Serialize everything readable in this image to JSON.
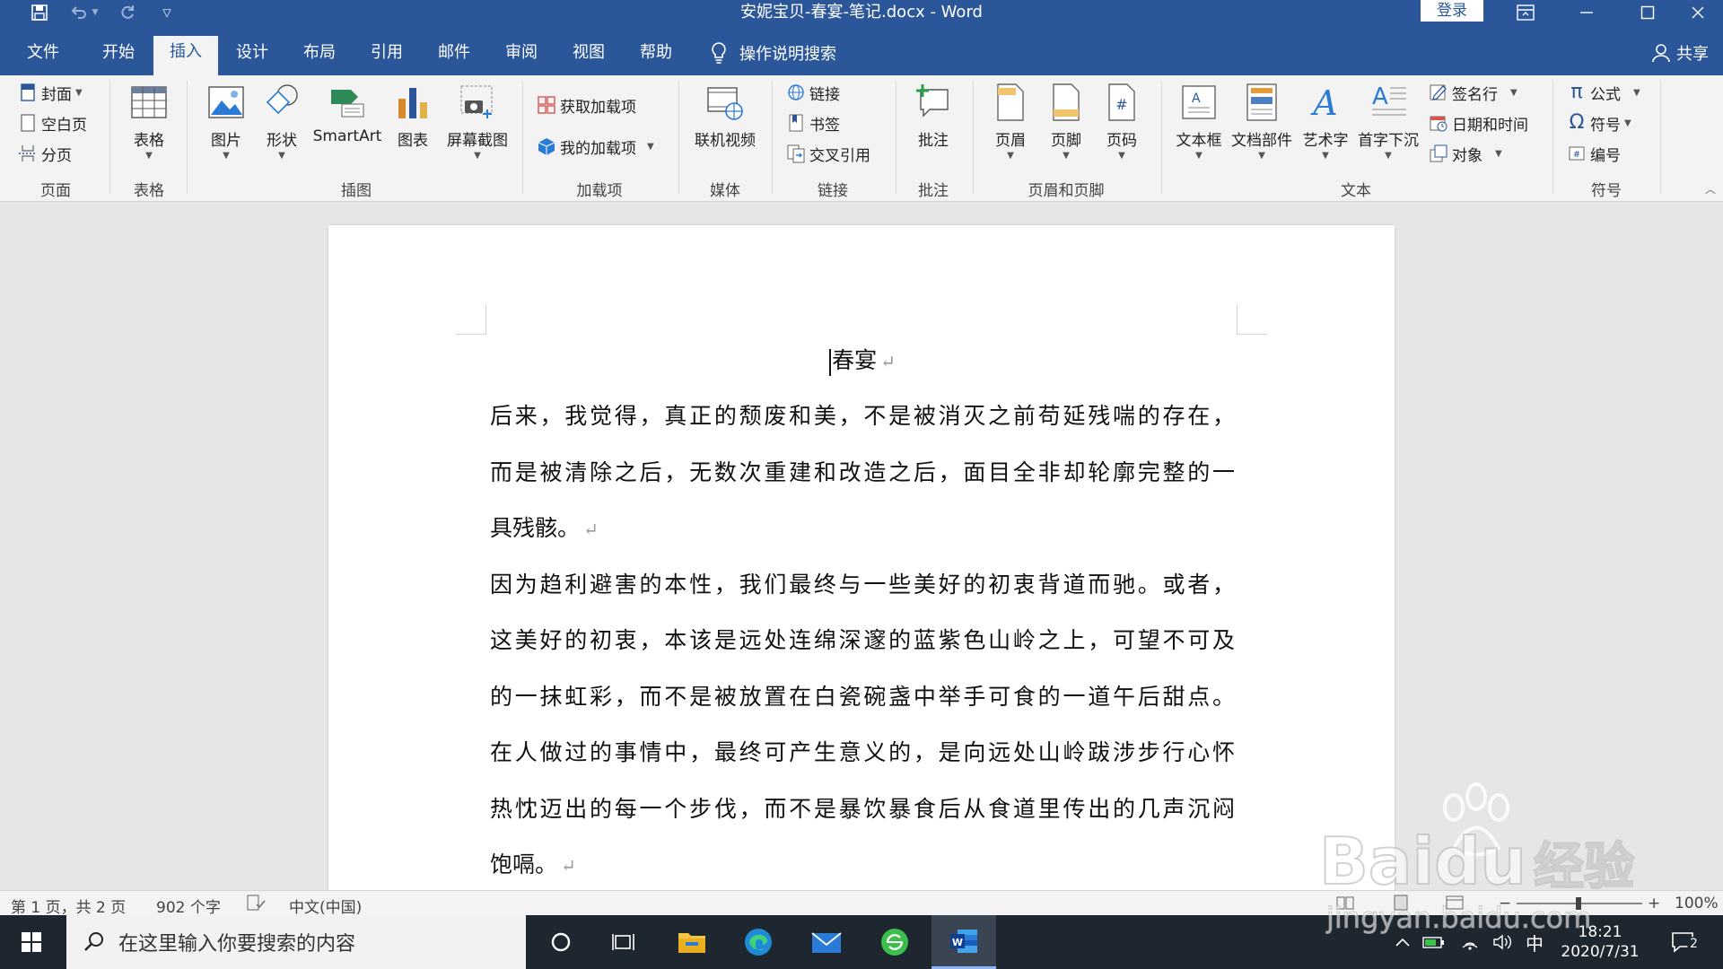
{
  "titlebar": {
    "title": "安妮宝贝-春宴-笔记.docx  -  Word",
    "login": "登录"
  },
  "tabs": [
    "文件",
    "开始",
    "插入",
    "设计",
    "布局",
    "引用",
    "邮件",
    "审阅",
    "视图",
    "帮助"
  ],
  "active_tab": "插入",
  "tell_me": "操作说明搜索",
  "share": "共享",
  "ribbon": {
    "pages": {
      "cover": "封面",
      "blank": "空白页",
      "break": "分页",
      "label": "页面"
    },
    "tables": {
      "table": "表格",
      "label": "表格"
    },
    "illustrations": {
      "picture": "图片",
      "shapes": "形状",
      "smartart": "SmartArt",
      "chart": "图表",
      "screenshot": "屏幕截图",
      "label": "插图"
    },
    "addins": {
      "get": "获取加载项",
      "my": "我的加载项",
      "label": "加载项"
    },
    "media": {
      "video": "联机视频",
      "label": "媒体"
    },
    "links": {
      "link": "链接",
      "bookmark": "书签",
      "cross": "交叉引用",
      "label": "链接"
    },
    "comments": {
      "comment": "批注",
      "label": "批注"
    },
    "header_footer": {
      "header": "页眉",
      "footer": "页脚",
      "page_number": "页码",
      "label": "页眉和页脚"
    },
    "text": {
      "textbox": "文本框",
      "quickparts": "文档部件",
      "wordart": "艺术字",
      "dropcap": "首字下沉",
      "signature": "签名行",
      "datetime": "日期和时间",
      "object": "对象",
      "label": "文本"
    },
    "symbols": {
      "equation": "公式",
      "symbol": "符号",
      "number": "编号",
      "label": "符号"
    }
  },
  "document": {
    "heading": "春宴",
    "lines": [
      "后来，我觉得，真正的颓废和美，不是被消灭之前苟延残喘的存在，",
      "而是被清除之后，无数次重建和改造之后，面目全非却轮廓完整的一",
      "具残骸。",
      "因为趋利避害的本性，我们最终与一些美好的初衷背道而驰。或者，",
      "这美好的初衷，本该是远处连绵深邃的蓝紫色山岭之上，可望不可及",
      "的一抹虹彩，而不是被放置在白瓷碗盏中举手可食的一道午后甜点。",
      "在人做过的事情中，最终可产生意义的，是向远处山岭跋涉步行心怀",
      "热忱迈出的每一个步伐，而不是暴饮暴食后从食道里传出的几声沉闷",
      "饱嗝。"
    ],
    "paragraph_mark": "↵"
  },
  "statusbar": {
    "page": "第 1 页，共 2 页",
    "words": "902 个字",
    "language": "中文(中国)",
    "zoom": "100%"
  },
  "taskbar": {
    "search_placeholder": "在这里输入你要搜索的内容",
    "ime": "中",
    "time": "18:21",
    "date": "2020/7/31",
    "notification_count": "2"
  },
  "watermark": {
    "brand": "Baidu",
    "cn": "经验",
    "url": "jingyan.baidu.com"
  },
  "colors": {
    "word_blue": "#2b579a",
    "ribbon_bg": "#f3f3f3",
    "taskbar": "#1e2630"
  }
}
